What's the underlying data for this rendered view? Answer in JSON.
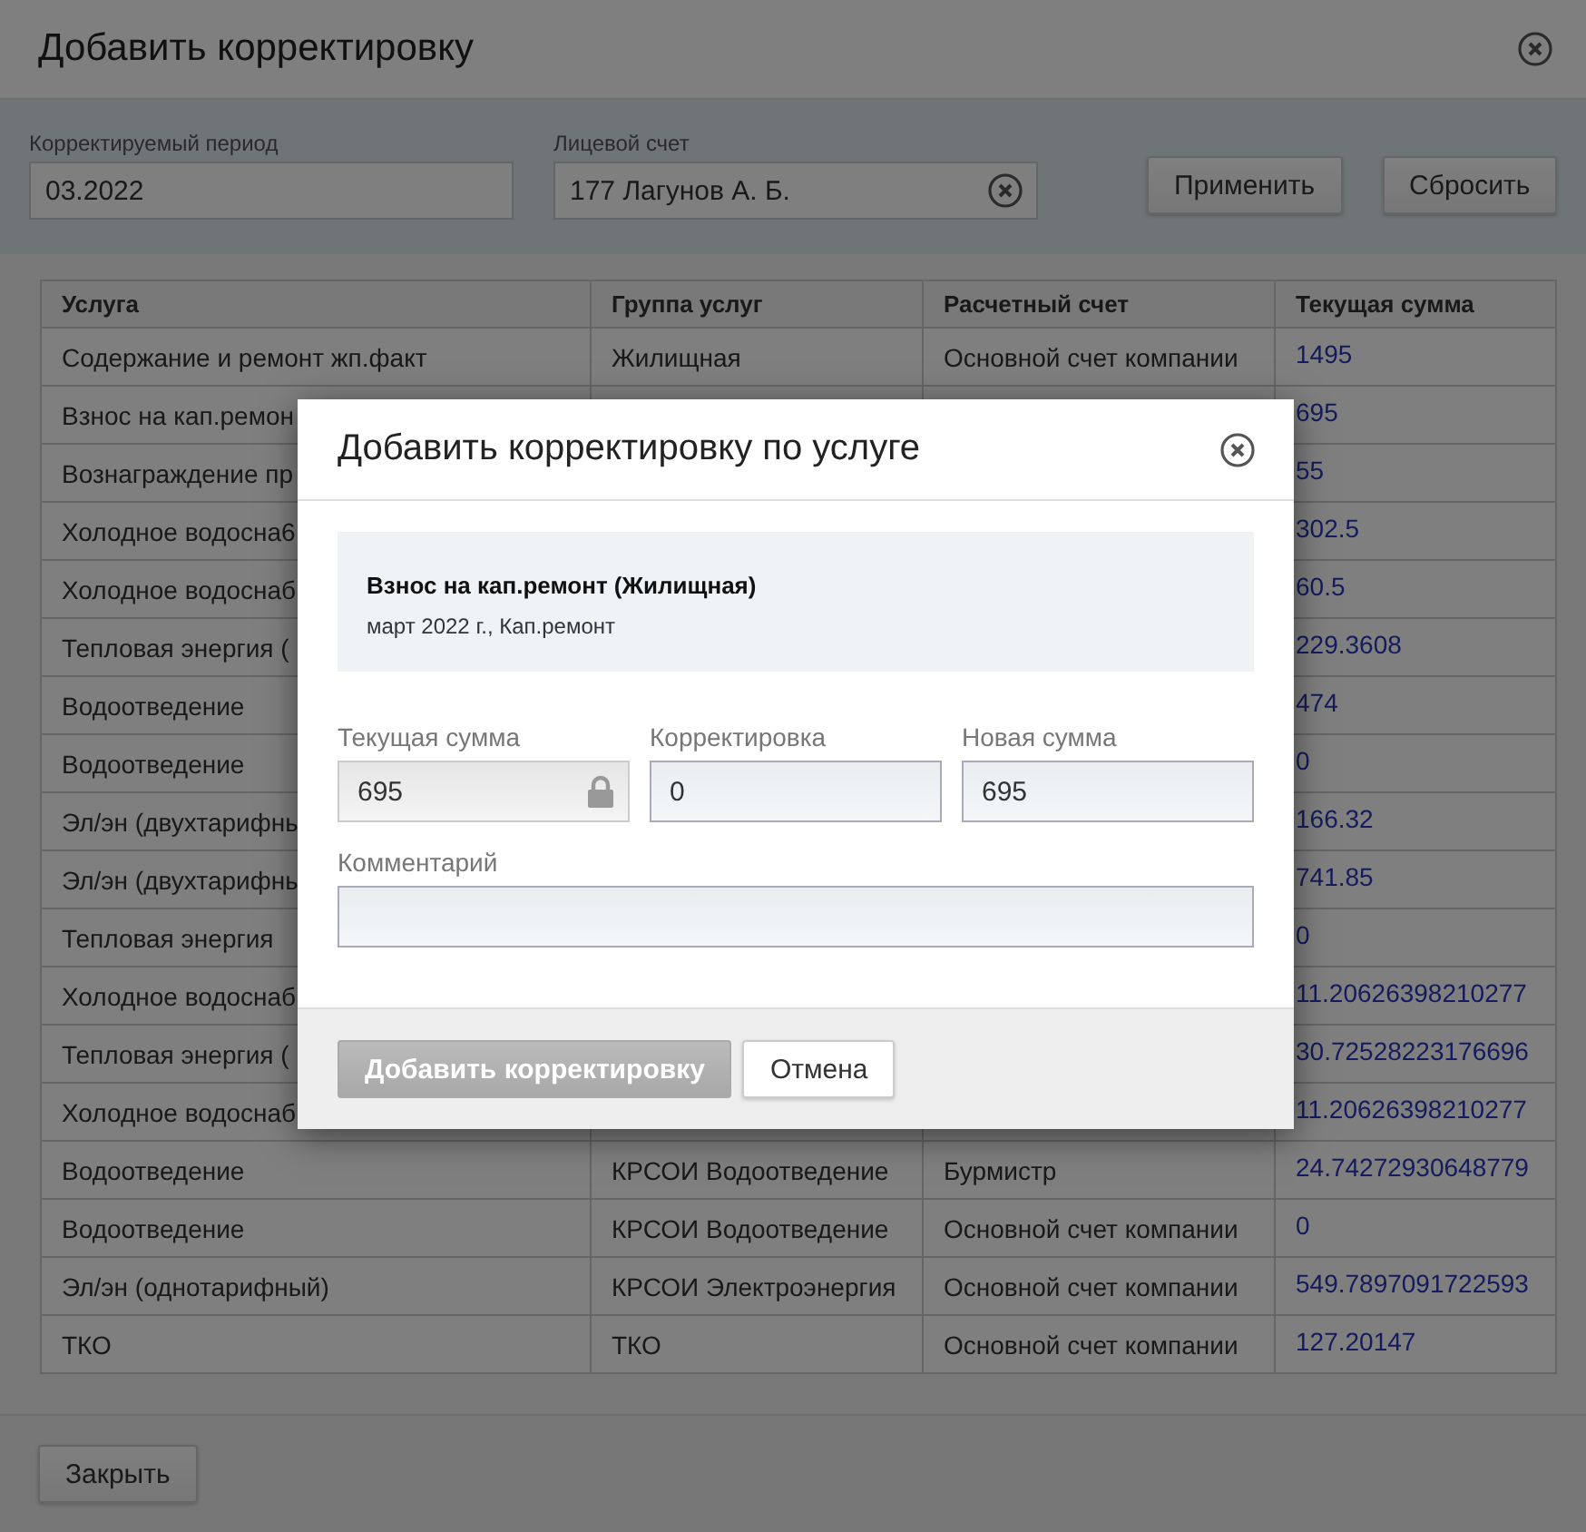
{
  "window": {
    "title": "Добавить корректировку"
  },
  "filters": {
    "period": {
      "label": "Корректируемый период",
      "value": "03.2022"
    },
    "account": {
      "label": "Лицевой счет",
      "value": "177 Лагунов А. Б."
    },
    "buttons": [
      "Применить",
      "Сбросить"
    ]
  },
  "table": {
    "columns": [
      "Услуга",
      "Группа услуг",
      "Расчетный счет",
      "Текущая сумма"
    ],
    "rows": [
      {
        "service": "Содержание и ремонт жп.факт",
        "group": "Жилищная",
        "account": "Основной счет компании",
        "amount": "1495"
      },
      {
        "service": "Взнос на кап.ремон",
        "amount": "695"
      },
      {
        "service": "Вознаграждение пр",
        "amount": "55"
      },
      {
        "service": "Холодное водосна6",
        "amount": "302.5"
      },
      {
        "service": "Холодное водоснаб",
        "amount": "60.5"
      },
      {
        "service": "Тепловая энергия (",
        "amount": "229.3608"
      },
      {
        "service": "Водоотведение",
        "amount": "474"
      },
      {
        "service": "Водоотведение",
        "amount": "0"
      },
      {
        "service": "Эл/эн (двухтарифны",
        "amount": "166.32"
      },
      {
        "service": "Эл/эн (двухтарифны",
        "amount": "741.85"
      },
      {
        "service": "Тепловая энергия",
        "amount": "0"
      },
      {
        "service": "Холодное водоснаб",
        "amount": "11.20626398210277"
      },
      {
        "service": "Тепловая энергия (",
        "amount": "30.72528223176696"
      },
      {
        "service": "Холодное водоснаб",
        "amount": "11.20626398210277"
      },
      {
        "service": "Водоотведение",
        "group": "КРСОИ Водоотведение",
        "account": "Бурмистр",
        "amount": "24.74272930648779"
      },
      {
        "service": "Водоотведение",
        "group": "КРСОИ Водоотведение",
        "account": "Основной счет компании",
        "amount": "0"
      },
      {
        "service": "Эл/эн (однотарифный)",
        "group": "КРСОИ Электроэнергия",
        "account": "Основной счет компании",
        "amount": "549.7897091722593"
      },
      {
        "service": "ТКО",
        "group": "ТКО",
        "account": "Основной счет компании",
        "amount": "127.20147"
      }
    ]
  },
  "footer": {
    "close_button": "Закрыть"
  },
  "dialog": {
    "title": "Добавить корректировку по услуге",
    "info": {
      "heading": "Взнос на кап.ремонт (Жилищная)",
      "subtitle": "март 2022 г., Кап.ремонт"
    },
    "fields": [
      {
        "label": "Текущая сумма",
        "value": "695",
        "locked": true
      },
      {
        "label": "Корректировка",
        "value": "0",
        "locked": false
      },
      {
        "label": "Новая сумма",
        "value": "695",
        "locked": false
      }
    ],
    "comment": {
      "label": "Комментарий"
    },
    "buttons": [
      {
        "label": "Добавить корректировку",
        "kind": "primary",
        "disabled": true
      },
      {
        "label": "Отмена",
        "kind": "secondary",
        "disabled": false
      }
    ]
  }
}
